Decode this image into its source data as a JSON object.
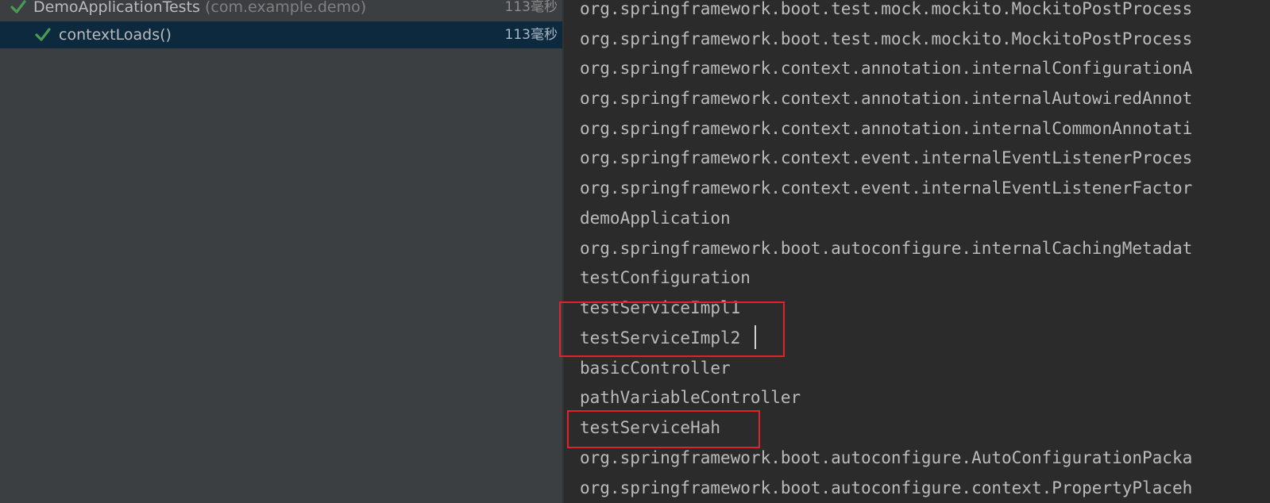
{
  "test_tree": {
    "rows": [
      {
        "label": "DemoApplicationTests",
        "package": "(com.example.demo)",
        "time": "113毫秒",
        "status_icon": "check-icon"
      },
      {
        "label": "contextLoads()",
        "time": "113毫秒",
        "status_icon": "check-icon"
      }
    ]
  },
  "console": {
    "lines": [
      "org.springframework.boot.test.mock.mockito.MockitoPostProcess",
      "org.springframework.boot.test.mock.mockito.MockitoPostProcess",
      "org.springframework.context.annotation.internalConfigurationA",
      "org.springframework.context.annotation.internalAutowiredAnnot",
      "org.springframework.context.annotation.internalCommonAnnotati",
      "org.springframework.context.event.internalEventListenerProces",
      "org.springframework.context.event.internalEventListenerFactor",
      "demoApplication",
      "org.springframework.boot.autoconfigure.internalCachingMetadat",
      "testConfiguration",
      "testServiceImpl1",
      "testServiceImpl2",
      "basicController",
      "pathVariableController",
      "testServiceHah",
      "org.springframework.boot.autoconfigure.AutoConfigurationPacka",
      "org.springframework.boot.autoconfigure.context.PropertyPlaceh"
    ]
  },
  "colors": {
    "success_check": "#499c54",
    "selection": "#0d293e",
    "annotation_box": "#e0222b"
  }
}
